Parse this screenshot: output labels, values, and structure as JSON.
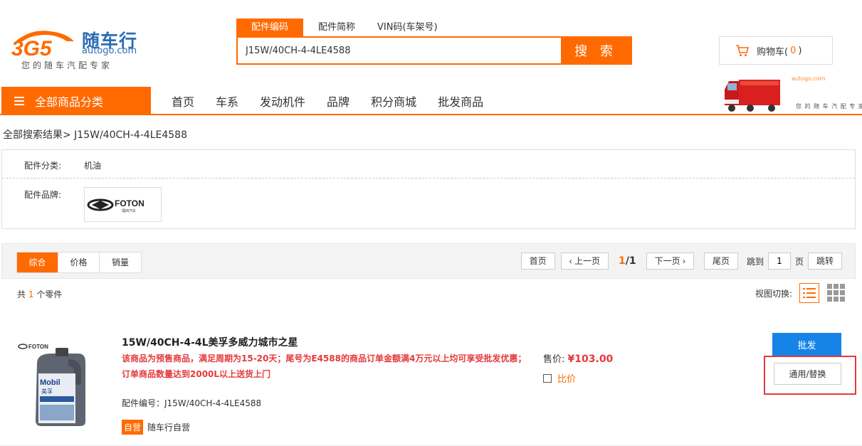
{
  "logo": {
    "mark_text": "3G5",
    "name_cn": "随车行",
    "name_en": "autogo.com",
    "slogan": "您的随车汽配专家"
  },
  "search": {
    "tabs": [
      "配件编码",
      "配件简称",
      "VIN码(车架号)"
    ],
    "active_tab": 0,
    "value": "J15W/40CH-4-4LE4588",
    "button_label": "搜 索"
  },
  "cart": {
    "label_prefix": "购物车(",
    "count": "0",
    "label_suffix": ")"
  },
  "nav": {
    "category_label": "全部商品分类",
    "links": [
      "首页",
      "车系",
      "发动机件",
      "品牌",
      "积分商城",
      "批发商品"
    ]
  },
  "banner": {
    "brand": "autogo.com",
    "slogan": "您 的 随 车 汽 配 专 家"
  },
  "breadcrumb": "全部搜索结果> J15W/40CH-4-4LE4588",
  "filter": {
    "category_label": "配件分类:",
    "category_value": "机油",
    "brand_label": "配件品牌:",
    "brand_logo_text": "FOTON",
    "brand_logo_sub": "福田汽车"
  },
  "sort": {
    "items": [
      "综合",
      "价格",
      "销量"
    ],
    "active": 0
  },
  "pager": {
    "first": "首页",
    "prev": "上一页",
    "current": "1",
    "total": "/1",
    "next": "下一页",
    "last": "尾页",
    "jump_label": "跳到",
    "jump_value": "1",
    "page_unit": "页",
    "go": "跳转"
  },
  "result": {
    "count_prefix": "共",
    "count": "1",
    "count_suffix": "个零件",
    "view_label": "视图切换:"
  },
  "product": {
    "title": "15W/40CH-4-4L美孚多威力城市之星",
    "notice": "该商品为预售商品，满足周期为15-20天；尾号为E4588的商品订单金额满4万元以上均可享受批发优惠；订单商品数量达到2000L以上送货上门",
    "part_no": "配件编号：J15W/40CH-4-4LE4588",
    "self_badge": "自营",
    "self_text": "随车行自营",
    "price_label": "售价:",
    "price": "¥103.00",
    "compare_label": "比价",
    "wholesale_label": "批发",
    "replace_label": "通用/替换",
    "image_brand": "FOTON",
    "image_mobil": "Mobil",
    "image_cn": "美孚"
  },
  "colors": {
    "accent": "#ff6a00",
    "price": "#e4393c",
    "wholesale": "#1683e8",
    "logo_blue": "#2a6db5"
  }
}
